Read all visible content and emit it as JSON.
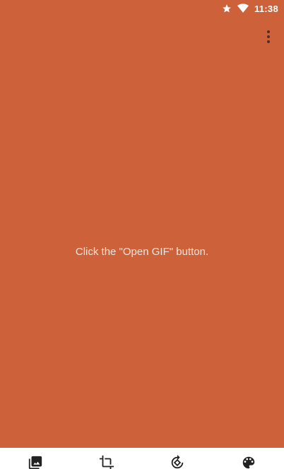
{
  "status_bar": {
    "time": "11:38",
    "icons": [
      "star-icon",
      "wifi-icon"
    ]
  },
  "main": {
    "hint": "Click the \"Open GIF\" button."
  },
  "toolbar": {
    "tools": [
      "image-icon",
      "crop-icon",
      "rotate-icon",
      "palette-icon"
    ]
  },
  "colors": {
    "background": "#cd613a",
    "toolbar": "#ffffff",
    "status_text": "#ffffff"
  }
}
